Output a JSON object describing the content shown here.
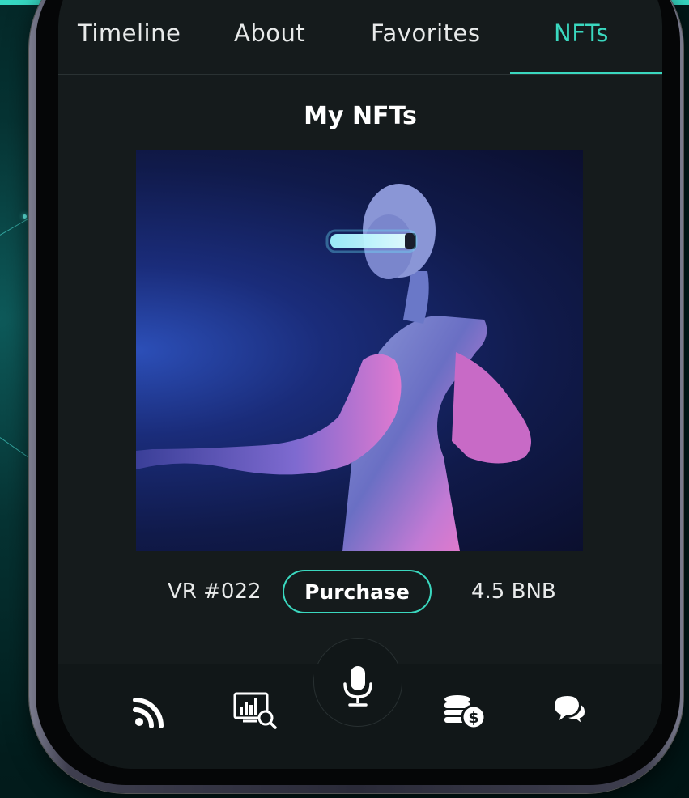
{
  "tabs": [
    {
      "label": "Timeline",
      "active": false
    },
    {
      "label": "About",
      "active": false
    },
    {
      "label": "Favorites",
      "active": false
    },
    {
      "label": "NFTs",
      "active": true
    }
  ],
  "section_title": "My NFTs",
  "nft": {
    "id_label": "VR #022",
    "purchase_label": "Purchase",
    "price": "4.5 BNB",
    "image_description_icon": "nft-artwork-image"
  },
  "bottom_nav": [
    {
      "icon": "rss-feed-icon"
    },
    {
      "icon": "analytics-search-icon"
    },
    {
      "icon": "microphone-icon"
    },
    {
      "icon": "coins-dollar-icon"
    },
    {
      "icon": "chat-bubbles-icon"
    }
  ],
  "colors": {
    "accent": "#3ad8bf",
    "screen_bg": "#151b1c",
    "text": "#e8eaea",
    "outer_bg": "#063333"
  }
}
